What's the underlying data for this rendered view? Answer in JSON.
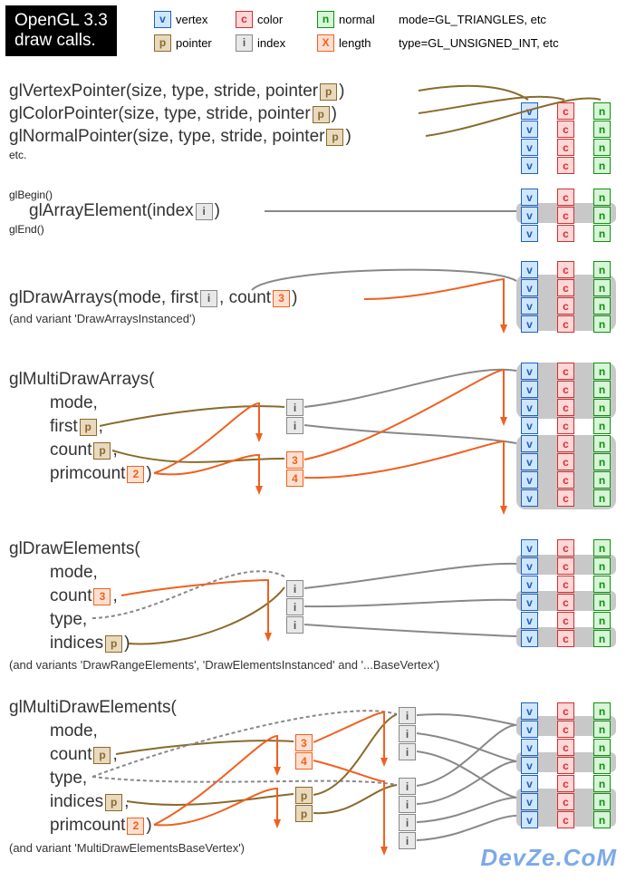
{
  "title_line1": "OpenGL 3.3",
  "title_line2": "draw calls.",
  "legend": {
    "vertex": "vertex",
    "color": "color",
    "normal": "normal",
    "pointer": "pointer",
    "index": "index",
    "length": "length",
    "mode": "mode=GL_TRIANGLES, etc",
    "type": "type=GL_UNSIGNED_INT, etc"
  },
  "glyph": {
    "v": "v",
    "c": "c",
    "n": "n",
    "p": "p",
    "i": "i",
    "x": "X",
    "n2": "2",
    "n3": "3",
    "n4": "4"
  },
  "sec1": {
    "l1a": "glVertexPointer(size, type, stride, pointer",
    "l1b": ")",
    "l2a": "glColorPointer(size, type, stride, pointer",
    "l2b": ")",
    "l3a": "glNormalPointer(size, type, stride, pointer",
    "l3b": ")",
    "etc": "etc."
  },
  "sec2": {
    "begin": "glBegin()",
    "ae_a": "glArrayElement(index",
    "ae_b": ")",
    "end": "glEnd()"
  },
  "sec3": {
    "a": "glDrawArrays(mode, first",
    "b": ", count",
    "c": ")",
    "note": "(and variant 'DrawArraysInstanced')"
  },
  "sec4": {
    "open": "glMultiDrawArrays(",
    "mode": "mode,",
    "first": "first",
    "firstcomma": ",",
    "count": "count",
    "countcomma": ",",
    "prim": "primcount",
    "close": ")"
  },
  "sec5": {
    "open": "glDrawElements(",
    "mode": "mode,",
    "count": "count",
    "countcomma": ",",
    "type": "type,",
    "indices": "indices",
    "close": ")",
    "note": "(and variants 'DrawRangeElements', 'DrawElementsInstanced' and '...BaseVertex')"
  },
  "sec6": {
    "open": "glMultiDrawElements(",
    "mode": "mode,",
    "count": "count",
    "countcomma": ",",
    "type": "type,",
    "indices": "indices",
    "indicescomma": ",",
    "prim": "primcount",
    "close": ")",
    "note": "(and variant 'MultiDrawElementsBaseVertex')"
  },
  "watermark": "DevZe.CoM"
}
